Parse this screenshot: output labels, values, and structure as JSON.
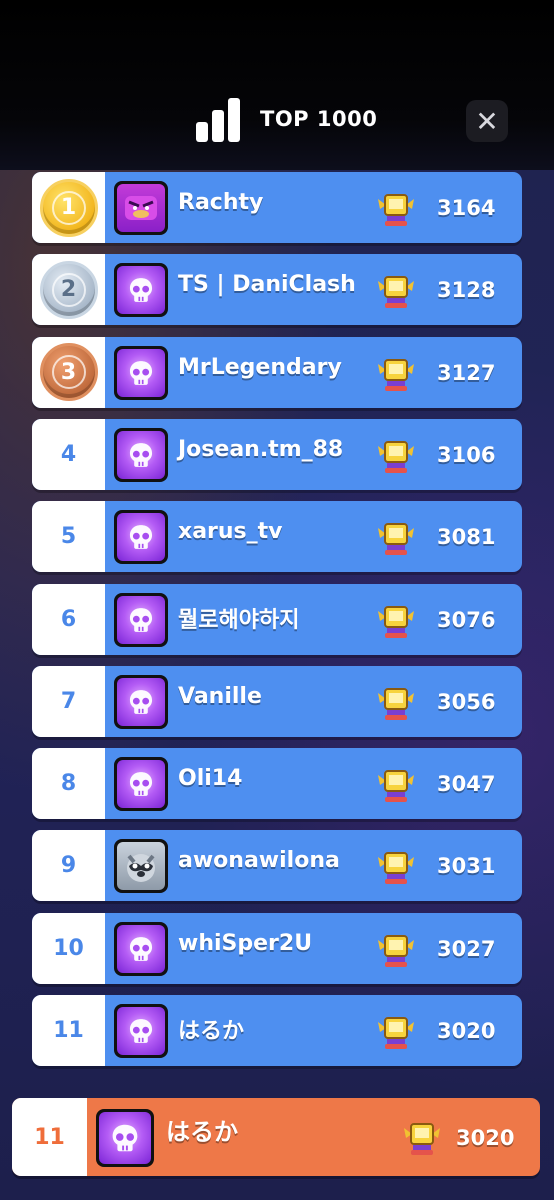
{
  "header": {
    "title": "TOP 1000",
    "close_glyph": "✕",
    "stats_icon": "bar-chart-icon"
  },
  "colors": {
    "row_blue": "#4e8ff0",
    "row_self": "#ee7848",
    "rank_text": "#4a87e8",
    "self_rank_text": "#ef6d3a"
  },
  "leaderboard": [
    {
      "rank": "1",
      "medal": "gold",
      "name": "Rachty",
      "score": "3164",
      "avatar": "purple-face-icon"
    },
    {
      "rank": "2",
      "medal": "silver",
      "name": "TS | DaniClash",
      "score": "3128",
      "avatar": "skull-icon"
    },
    {
      "rank": "3",
      "medal": "bronze",
      "name": "MrLegendary",
      "score": "3127",
      "avatar": "skull-icon"
    },
    {
      "rank": "4",
      "medal": "",
      "name": "Josean.tm_88",
      "score": "3106",
      "avatar": "skull-icon"
    },
    {
      "rank": "5",
      "medal": "",
      "name": "xarus_tv",
      "score": "3081",
      "avatar": "skull-icon"
    },
    {
      "rank": "6",
      "medal": "",
      "name": "뭘로해야하지",
      "score": "3076",
      "avatar": "skull-icon"
    },
    {
      "rank": "7",
      "medal": "",
      "name": "Vanille",
      "score": "3056",
      "avatar": "skull-icon"
    },
    {
      "rank": "8",
      "medal": "",
      "name": "Oli14",
      "score": "3047",
      "avatar": "skull-icon"
    },
    {
      "rank": "9",
      "medal": "",
      "name": "awonawilona",
      "score": "3031",
      "avatar": "raccoon-icon"
    },
    {
      "rank": "10",
      "medal": "",
      "name": "whiSper2U",
      "score": "3027",
      "avatar": "skull-icon"
    },
    {
      "rank": "11",
      "medal": "",
      "name": "はるか",
      "score": "3020",
      "avatar": "skull-icon"
    }
  ],
  "self": {
    "rank": "11",
    "name": "はるか",
    "score": "3020",
    "avatar": "skull-icon"
  }
}
